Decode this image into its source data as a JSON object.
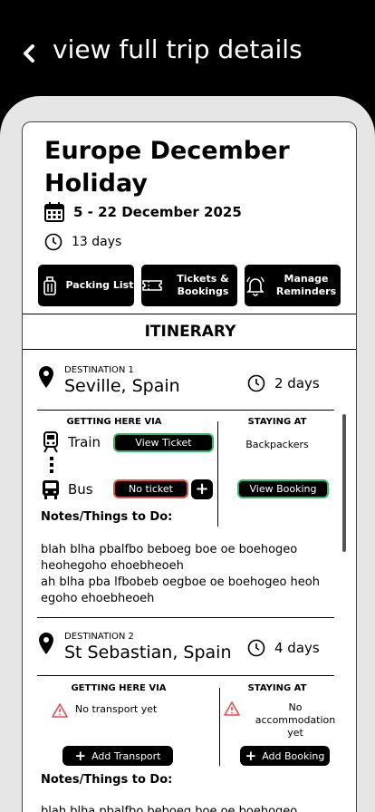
{
  "header": {
    "title": "view full trip details"
  },
  "trip": {
    "title": "Europe December Holiday",
    "dates": "5 - 22 December 2025",
    "duration": "13 days"
  },
  "actions": [
    {
      "label": "Packing List",
      "icon": "luggage-icon"
    },
    {
      "label": "Tickets & Bookings",
      "icon": "ticket-icon"
    },
    {
      "label": "Manage Reminders",
      "icon": "bell-icon"
    }
  ],
  "itinerary": {
    "heading": "ITINERARY",
    "destinations": [
      {
        "label": "DESTINATION 1",
        "name": "Seville, Spain",
        "days": "2 days",
        "getting_here_heading": "GETTING HERE VIA",
        "staying_at_heading": "STAYING AT",
        "transport": [
          {
            "mode": "Train",
            "button": "View Ticket",
            "status": "green"
          },
          {
            "mode": "Bus",
            "button": "No ticket",
            "status": "red"
          }
        ],
        "staying_at": "Backpackers",
        "staying_button": "View Booking",
        "notes_heading": "Notes/Things to Do:",
        "notes": "blah blha pbalfbo beboeg boe oe boehogeo heohegoho ehoebheoeh\nah blha pba lfbobeb oegboe oe boehogeo heoh egoho ehoebheoeh"
      },
      {
        "label": "DESTINATION 2",
        "name": "St Sebastian, Spain",
        "days": "4 days",
        "getting_here_heading": "GETTING HERE VIA",
        "staying_at_heading": "STAYING AT",
        "no_transport": "No transport yet",
        "no_accommodation": "No accommodation yet",
        "add_transport": "Add Transport",
        "add_booking": "Add Booking",
        "notes_heading": "Notes/Things to Do:",
        "notes": "blah blha pbalfbo beboeg boe oe boehogeo"
      }
    ]
  },
  "colors": {
    "ok": "#38b56a",
    "missing": "#e05050",
    "warning": "#e05050"
  }
}
